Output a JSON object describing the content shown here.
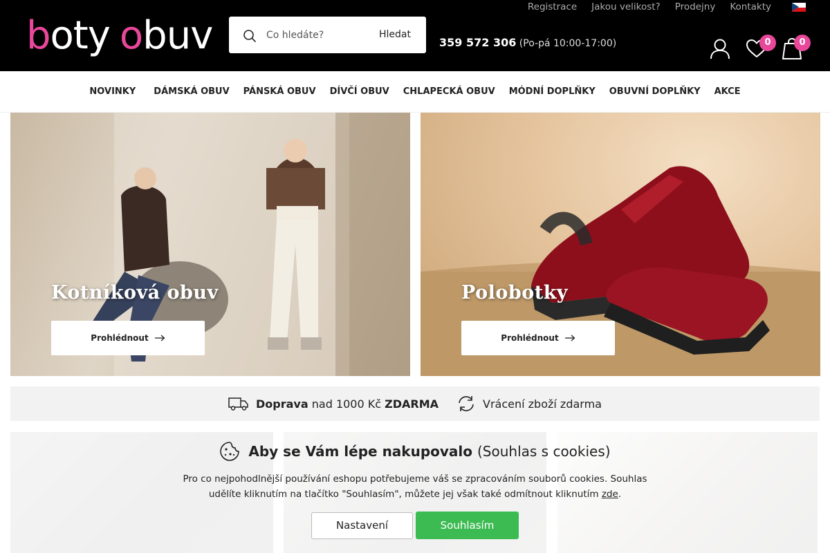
{
  "brand": {
    "logo_part1": "b",
    "logo_part2": "oty",
    "logo_part3": "o",
    "logo_part4": "buv",
    "accent_color": "#e8479a"
  },
  "header": {
    "search_placeholder": "Co hledáte?",
    "search_button": "Hledat",
    "phone": "359 572 306",
    "hours": "(Po-pá 10:00-17:00)",
    "top_links": [
      "Registrace",
      "Jakou velikost?",
      "Prodejny",
      "Kontakty"
    ],
    "wishlist_count": "0",
    "cart_count": "0",
    "language_flag": "czech-flag"
  },
  "nav": {
    "items": [
      "NOVINKY",
      "DÁMSKÁ OBUV",
      "PÁNSKÁ OBUV",
      "DÍVČÍ OBUV",
      "CHLAPECKÁ OBUV",
      "MÓDNÍ DOPLŇKY",
      "OBUVNÍ DOPLŇKY",
      "AKCE"
    ]
  },
  "hero": {
    "tiles": [
      {
        "title": "Kotníková obuv",
        "button": "Prohlédnout"
      },
      {
        "title": "Polobotky",
        "button": "Prohlédnout"
      }
    ]
  },
  "benefits": {
    "shipping_bold": "Doprava",
    "shipping_text": "nad 1000 Kč",
    "shipping_free": "ZDARMA",
    "returns": "Vrácení zboží zdarma"
  },
  "cookies": {
    "title_bold": "Aby se Vám lépe nakupovalo",
    "title_normal": "(Souhlas s cookies)",
    "text": "Pro co nejpohodlnější používání eshopu potřebujeme váš se zpracováním souborů cookies. Souhlas udělíte kliknutím na tlačítko \"Souhlasím\", můžete jej však také odmítnout kliknutím",
    "link": "zde",
    "settings_button": "Nastavení",
    "accept_button": "Souhlasím",
    "accept_color": "#3dbb53"
  }
}
